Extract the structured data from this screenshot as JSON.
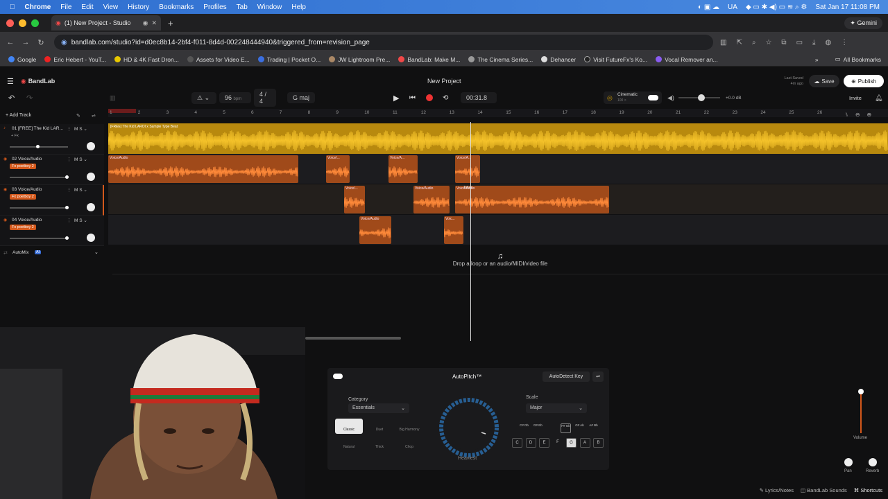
{
  "mac": {
    "app": "Chrome",
    "menus": [
      "File",
      "Edit",
      "View",
      "History",
      "Bookmarks",
      "Profiles",
      "Tab",
      "Window",
      "Help"
    ],
    "lang": "UA",
    "datetime": "Sat Jan 17  11:08 PM"
  },
  "browser": {
    "tab_title": "(1) New Project - Studio",
    "gemini": "Gemini",
    "url": "bandlab.com/studio?id=d0ec8b14-2bf4-f011-8d4d-002248444940&triggered_from=revision_page",
    "bookmarks": [
      "Google",
      "Eric Hebert - YouT...",
      "HD & 4K Fast Dron...",
      "Assets for Video E...",
      "Trading | Pocket O...",
      "JW Lightroom Pre...",
      "BandLab: Make M...",
      "The Cinema Series...",
      "Dehancer",
      "Visit FutureFx's Ko...",
      "Vocal Remover an..."
    ],
    "all_bookmarks": "All Bookmarks"
  },
  "bandlab": {
    "logo": "BandLab",
    "project": "New Project",
    "last_saved": "Last Saved",
    "saved_ago": "4m ago",
    "save": "Save",
    "publish": "Publish",
    "invite": "Invite",
    "bpm": "96",
    "bpm_unit": "bpm",
    "time_sig": "4 / 4",
    "key": "G maj",
    "time": "00:31.8",
    "cinematic": "Cinematic",
    "cinematic_sub": "100 >",
    "gain": "+0.0 dB",
    "add_track": "Add Track",
    "automix": "AutoMix",
    "ai": "AI",
    "drop_text": "Drop a loop or an audio/MIDI/video file"
  },
  "tracks": [
    {
      "num": "01",
      "name": "[FREE] The Kid LAR...",
      "fx": "+ Fx",
      "slider": 0.45
    },
    {
      "num": "02",
      "name": "Voice/Audio",
      "fx": "Fx  poetboy 2",
      "slider": 0.95
    },
    {
      "num": "03",
      "name": "Voice/Audio",
      "fx": "Fx  poetboy 2",
      "slider": 0.95
    },
    {
      "num": "04",
      "name": "Voice/Audio",
      "fx": "Fx  poetboy 2",
      "slider": 0.95
    }
  ],
  "ruler": [
    "1",
    "2",
    "3",
    "4",
    "5",
    "6",
    "7",
    "8",
    "9",
    "10",
    "11",
    "12",
    "13",
    "14",
    "15",
    "16",
    "17",
    "18",
    "19",
    "20",
    "21",
    "22",
    "23",
    "24",
    "25",
    "26"
  ],
  "beat_clip_label": "[FREE] The Kid LAROI x Sample Type Beat",
  "clip_labels": {
    "long": "Voice/Audio",
    "short": "Voice/...",
    "shorter": "Voice/A...",
    "tiny": "Voic...",
    "takes": "Takes",
    "voice_a": "Voice/A..."
  },
  "autopitch": {
    "title": "AutoPitch™",
    "autodetect": "AutoDetect Key",
    "category_label": "Category",
    "category_value": "Essentials",
    "scale_label": "Scale",
    "scale_value": "Major",
    "modes": [
      "Classic",
      "Duet",
      "Big Harmony",
      "Natural",
      "Thick",
      "Chop"
    ],
    "knob_label": "Heaviest",
    "sharps": [
      "C#\nDb",
      "D#\nEb",
      "F#\nGb",
      "G#\nAb",
      "A#\nBb"
    ],
    "keys": [
      "C",
      "D",
      "E",
      "F",
      "G",
      "A",
      "B"
    ],
    "volume": "Volume",
    "pan": "Pan",
    "reverb": "Reverb"
  },
  "footer": {
    "lyrics": "Lyrics/Notes",
    "sounds": "BandLab Sounds",
    "shortcuts": "Shortcuts"
  }
}
